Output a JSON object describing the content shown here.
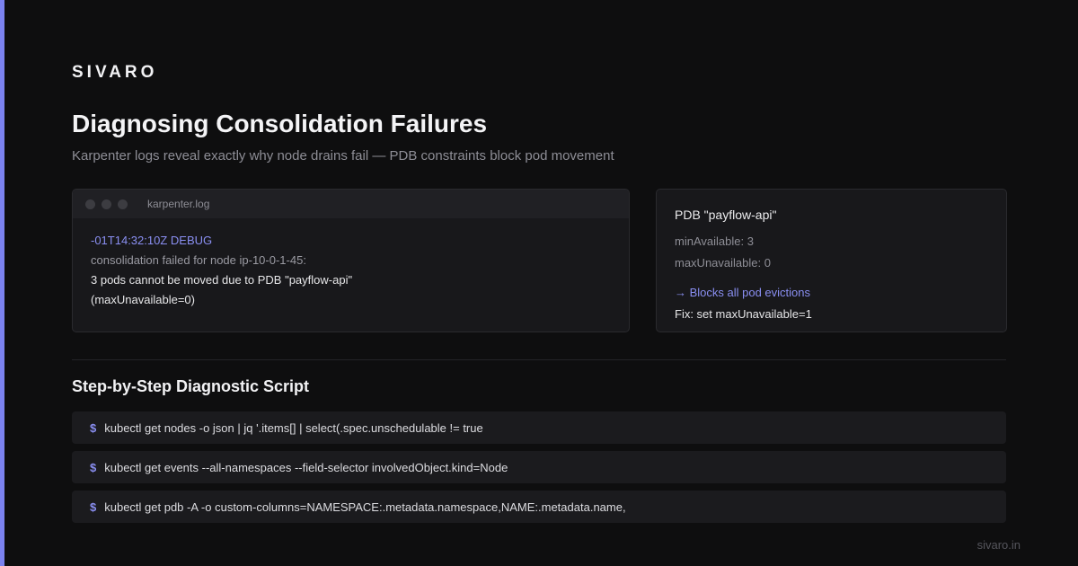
{
  "brand": "SIVARO",
  "title": "Diagnosing Consolidation Failures",
  "subtitle": "Karpenter logs reveal exactly why node drains fail — PDB constraints block pod movement",
  "log": {
    "filename": "karpenter.log",
    "lines": [
      "-01T14:32:10Z DEBUG",
      "consolidation failed for node ip-10-0-1-45:",
      "3 pods cannot be moved due to PDB \"payflow-api\"",
      "(maxUnavailable=0)"
    ]
  },
  "pdb": {
    "title": "PDB \"payflow-api\"",
    "min_available": "minAvailable: 3",
    "max_unavailable": "maxUnavailable: 0",
    "blocks": "→ Blocks all pod evictions",
    "fix": "Fix: set maxUnavailable=1"
  },
  "section_title": "Step-by-Step Diagnostic Script",
  "commands": [
    {
      "prompt": "$",
      "text": "kubectl get nodes -o json | jq '.items[] | select(.spec.unschedulable != true"
    },
    {
      "prompt": "$",
      "text": "kubectl get events --all-namespaces --field-selector involvedObject.kind=Node"
    },
    {
      "prompt": "$",
      "text": "kubectl get pdb -A -o custom-columns=NAMESPACE:.metadata.namespace,NAME:.metadata.name,"
    }
  ],
  "footer": "sivaro.in",
  "colors": {
    "accent": "#7b82f0",
    "background": "#0e0e0f",
    "panel": "#18181b"
  }
}
